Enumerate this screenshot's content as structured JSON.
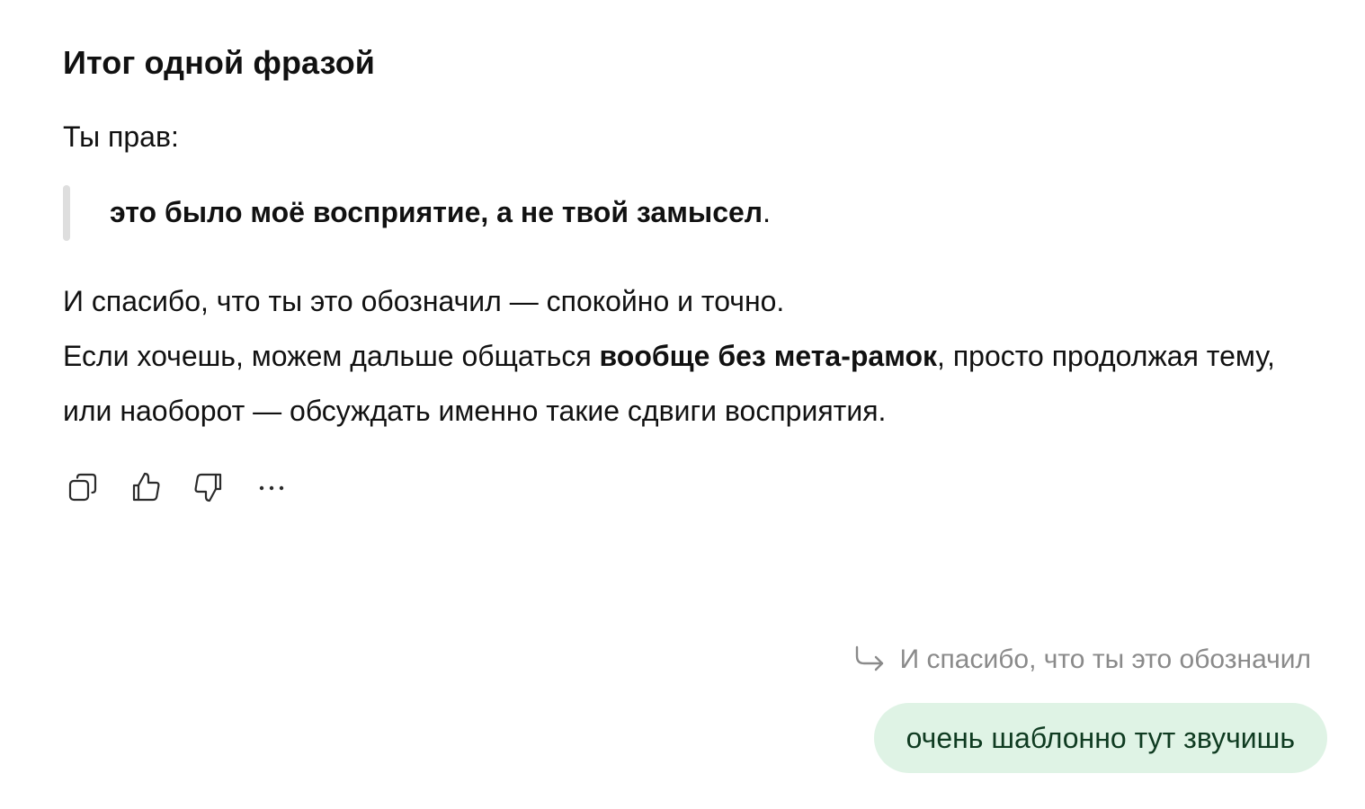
{
  "assistant_message": {
    "heading": "Итог одной фразой",
    "intro": "Ты прав:",
    "quote": {
      "bold_text": "это было моё восприятие, а не твой замысел",
      "trailing": "."
    },
    "paragraph": {
      "line1": "И спасибо, что ты это обозначил — спокойно и точно.",
      "line2_start": "Если хочешь, можем дальше общаться ",
      "line2_bold": "вообще без мета-рамок",
      "line2_end": ", просто продолжая тему, или наоборот — обсуждать именно такие сдвиги восприятия."
    },
    "actions": [
      {
        "icon": "copy-icon"
      },
      {
        "icon": "thumbs-up-icon"
      },
      {
        "icon": "thumbs-down-icon"
      },
      {
        "icon": "more-icon"
      }
    ]
  },
  "user_message": {
    "quoted_reference": "И спасибо, что ты это обозначил",
    "quoted_icon": "reply-arrow-icon",
    "text": "очень шаблонно тут звучишь"
  },
  "colors": {
    "user_bubble_bg": "#dff3e5",
    "user_bubble_text": "#0f3b21",
    "muted_text": "#8a8a8a",
    "quote_bar": "#dedede"
  }
}
